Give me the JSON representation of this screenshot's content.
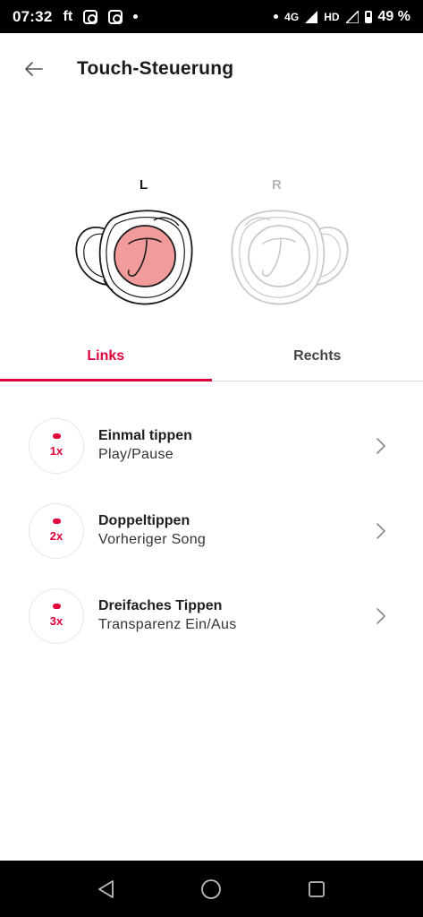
{
  "status_bar": {
    "time": "07:32",
    "app_label": "ft",
    "network": "4G",
    "hd": "HD",
    "battery": "49 %"
  },
  "header": {
    "title": "Touch-Steuerung"
  },
  "earbuds": {
    "left_label": "L",
    "right_label": "R",
    "accent_color": "#e2003c",
    "left_fill": "#f29b9b",
    "selected": "L"
  },
  "tabs": [
    {
      "label": "Links",
      "active": true
    },
    {
      "label": "Rechts",
      "active": false
    }
  ],
  "gestures": [
    {
      "count": "1x",
      "title": "Einmal tippen",
      "action": "Play/Pause"
    },
    {
      "count": "2x",
      "title": "Doppeltippen",
      "action": "Vorheriger Song"
    },
    {
      "count": "3x",
      "title": "Dreifaches Tippen",
      "action": "Transparenz Ein/Aus"
    }
  ]
}
